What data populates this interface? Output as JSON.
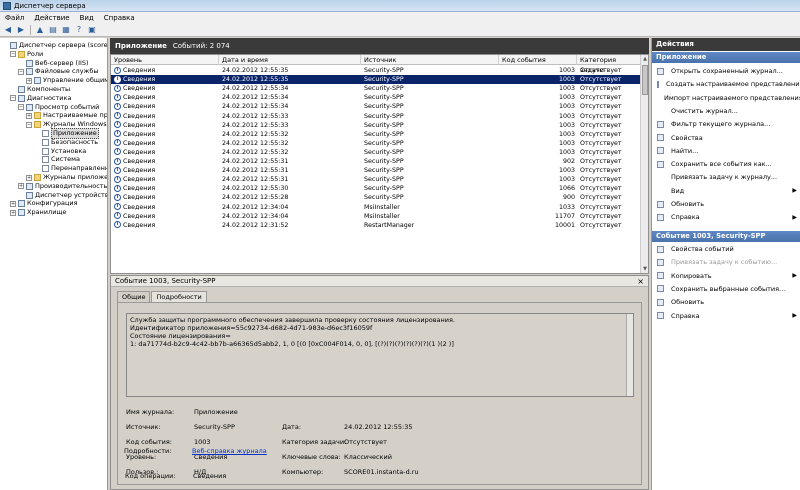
{
  "window": {
    "title": "Диспетчер сервера"
  },
  "menu": [
    "Файл",
    "Действие",
    "Вид",
    "Справка"
  ],
  "toolbar": [
    "back-arrow-icon",
    "forward-arrow-icon",
    "folder-up-icon",
    "show-hide-tree-icon",
    "properties-icon",
    "help-icon",
    "pane-icon"
  ],
  "tree": [
    {
      "label": "Диспетчер сервера (score01)",
      "indent": 0,
      "exp": "",
      "icon": "computer"
    },
    {
      "label": "Роли",
      "indent": 1,
      "exp": "−",
      "icon": "folder"
    },
    {
      "label": "Веб-сервер (IIS)",
      "indent": 2,
      "exp": "",
      "icon": "role"
    },
    {
      "label": "Файловые службы",
      "indent": 2,
      "exp": "−",
      "icon": "role"
    },
    {
      "label": "Управление общими р",
      "indent": 3,
      "exp": "+",
      "icon": "role"
    },
    {
      "label": "Компоненты",
      "indent": 1,
      "exp": "",
      "icon": "role"
    },
    {
      "label": "Диагностика",
      "indent": 1,
      "exp": "−",
      "icon": "role"
    },
    {
      "label": "Просмотр событий",
      "indent": 2,
      "exp": "−",
      "icon": "role"
    },
    {
      "label": "Настраиваемые предс",
      "indent": 3,
      "exp": "+",
      "icon": "folder"
    },
    {
      "label": "Журналы Windows",
      "indent": 3,
      "exp": "−",
      "icon": "folder"
    },
    {
      "label": "Приложение",
      "indent": 4,
      "exp": "",
      "icon": "log",
      "selected": true
    },
    {
      "label": "Безопасность",
      "indent": 4,
      "exp": "",
      "icon": "log"
    },
    {
      "label": "Установка",
      "indent": 4,
      "exp": "",
      "icon": "log"
    },
    {
      "label": "Система",
      "indent": 4,
      "exp": "",
      "icon": "log"
    },
    {
      "label": "Перенаправленны",
      "indent": 4,
      "exp": "",
      "icon": "log"
    },
    {
      "label": "Журналы приложений",
      "indent": 3,
      "exp": "+",
      "icon": "folder"
    },
    {
      "label": "Производительность",
      "indent": 2,
      "exp": "+",
      "icon": "role"
    },
    {
      "label": "Диспетчер устройств",
      "indent": 2,
      "exp": "",
      "icon": "role"
    },
    {
      "label": "Конфигурация",
      "indent": 1,
      "exp": "+",
      "icon": "role"
    },
    {
      "label": "Хранилище",
      "indent": 1,
      "exp": "+",
      "icon": "role"
    }
  ],
  "log": {
    "name": "Приложение",
    "count_text": "Событий: 2 074",
    "columns": [
      "Уровень",
      "Дата и время",
      "Источник",
      "Код события",
      "Категория задачи"
    ],
    "rows": [
      [
        "Сведения",
        "24.02.2012 12:55:35",
        "Security-SPP",
        "1003",
        "Отсутствует"
      ],
      [
        "Сведения",
        "24.02.2012 12:55:35",
        "Security-SPP",
        "1003",
        "Отсутствует"
      ],
      [
        "Сведения",
        "24.02.2012 12:55:34",
        "Security-SPP",
        "1003",
        "Отсутствует"
      ],
      [
        "Сведения",
        "24.02.2012 12:55:34",
        "Security-SPP",
        "1003",
        "Отсутствует"
      ],
      [
        "Сведения",
        "24.02.2012 12:55:34",
        "Security-SPP",
        "1003",
        "Отсутствует"
      ],
      [
        "Сведения",
        "24.02.2012 12:55:33",
        "Security-SPP",
        "1003",
        "Отсутствует"
      ],
      [
        "Сведения",
        "24.02.2012 12:55:33",
        "Security-SPP",
        "1003",
        "Отсутствует"
      ],
      [
        "Сведения",
        "24.02.2012 12:55:32",
        "Security-SPP",
        "1003",
        "Отсутствует"
      ],
      [
        "Сведения",
        "24.02.2012 12:55:32",
        "Security-SPP",
        "1003",
        "Отсутствует"
      ],
      [
        "Сведения",
        "24.02.2012 12:55:32",
        "Security-SPP",
        "1003",
        "Отсутствует"
      ],
      [
        "Сведения",
        "24.02.2012 12:55:31",
        "Security-SPP",
        "902",
        "Отсутствует"
      ],
      [
        "Сведения",
        "24.02.2012 12:55:31",
        "Security-SPP",
        "1003",
        "Отсутствует"
      ],
      [
        "Сведения",
        "24.02.2012 12:55:31",
        "Security-SPP",
        "1003",
        "Отсутствует"
      ],
      [
        "Сведения",
        "24.02.2012 12:55:30",
        "Security-SPP",
        "1066",
        "Отсутствует"
      ],
      [
        "Сведения",
        "24.02.2012 12:55:28",
        "Security-SPP",
        "900",
        "Отсутствует"
      ],
      [
        "Сведения",
        "24.02.2012 12:34:04",
        "MsiInstaller",
        "1033",
        "Отсутствует"
      ],
      [
        "Сведения",
        "24.02.2012 12:34:04",
        "MsiInstaller",
        "11707",
        "Отсутствует"
      ],
      [
        "Сведения",
        "24.02.2012 12:31:52",
        "RestartManager",
        "10001",
        "Отсутствует"
      ]
    ],
    "selected_row": 1
  },
  "detail": {
    "title": "Событие 1003, Security-SPP",
    "close": "×",
    "tabs": [
      "Общие",
      "Подробности"
    ],
    "message": [
      "Служба защиты программного обеспечения завершила проверку состояния лицензирования.",
      "Идентификатор приложения=55c92734-d682-4d71-983e-d6ec3f16059f",
      "Состояние лицензирования=",
      "1: da71774d-b2c9-4c42-bb7b-a66365d5abb2, 1, 0 [(0 [0xC004F014, 0, 0], [(?)(?)(?)(?)(?)(?)(1 )(2 )]"
    ],
    "fields": {
      "journal_label": "Имя журнала:",
      "journal": "Приложение",
      "source_label": "Источник:",
      "source": "Security-SPP",
      "date_label": "Дата:",
      "date": "24.02.2012 12:55:35",
      "code_label": "Код события:",
      "code": "1003",
      "task_label": "Категория задачи:",
      "task": "Отсутствует",
      "level_label": "Уровень:",
      "level": "Сведения",
      "keywords_label": "Ключевые слова:",
      "keywords": "Классический",
      "user_label": "Пользов.:",
      "user": "Н/Д",
      "computer_label": "Компьютер:",
      "computer": "SCORE01.instanta-d.ru",
      "opcode_label": "Код операции:",
      "opcode": "Сведения",
      "more_label": "Подробности:",
      "more_link": "Веб-справка журнала"
    }
  },
  "actions": {
    "header": "Действия",
    "section1": "Приложение",
    "items1": [
      {
        "label": "Открыть сохраненный журнал...",
        "icon": "open-log-icon"
      },
      {
        "label": "Создать настраиваемое представлени...",
        "icon": "filter-icon"
      },
      {
        "label": "Импорт настраиваемого представления",
        "icon": ""
      },
      {
        "label": "Очистить журнал...",
        "icon": ""
      },
      {
        "label": "Фильтр текущего журнала...",
        "icon": "filter-icon"
      },
      {
        "label": "Свойства",
        "icon": "properties-icon"
      },
      {
        "label": "Найти...",
        "icon": "find-icon"
      },
      {
        "label": "Сохранить все события как...",
        "icon": "save-icon"
      },
      {
        "label": "Привязать задачу к журналу...",
        "icon": ""
      },
      {
        "label": "Вид",
        "icon": "",
        "submenu": true
      },
      {
        "label": "Обновить",
        "icon": "refresh-icon"
      },
      {
        "label": "Справка",
        "icon": "help-icon",
        "submenu": true
      }
    ],
    "section2": "Событие 1003, Security-SPP",
    "items2": [
      {
        "label": "Свойства событий",
        "icon": "properties-icon"
      },
      {
        "label": "Привязать задачу к событию...",
        "icon": "task-icon",
        "disabled": true
      },
      {
        "label": "Копировать",
        "icon": "copy-icon",
        "submenu": true
      },
      {
        "label": "Сохранить выбранные события...",
        "icon": "save-icon"
      },
      {
        "label": "Обновить",
        "icon": "refresh-icon"
      },
      {
        "label": "Справка",
        "icon": "help-icon",
        "submenu": true
      }
    ]
  },
  "colors": {
    "selection": "#0a246a",
    "panel_header": "#3a3a3a",
    "actions_section": "#4a72ad"
  }
}
